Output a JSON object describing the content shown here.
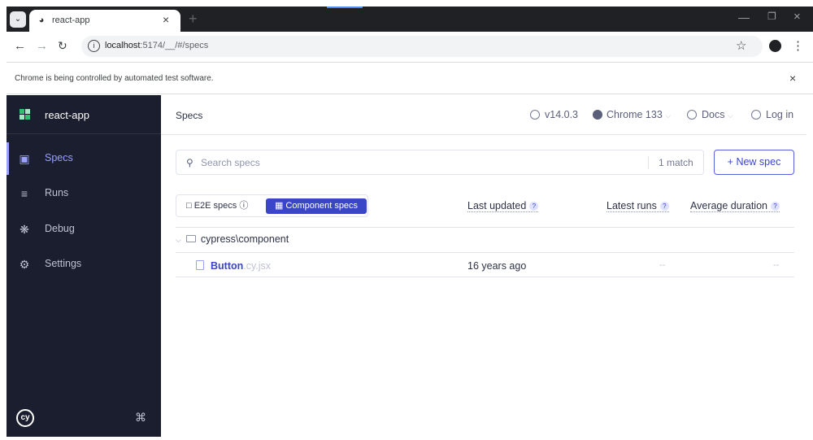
{
  "browser": {
    "tab_title": "react-app",
    "url_host": "localhost",
    "url_path": ":5174/__/#/specs",
    "infobar_text": "Chrome is being controlled by automated test software."
  },
  "sidebar": {
    "app_name": "react-app",
    "items": [
      {
        "label": "Specs",
        "icon": "specs-icon",
        "active": true
      },
      {
        "label": "Runs",
        "icon": "runs-icon",
        "active": false
      },
      {
        "label": "Debug",
        "icon": "bug-icon",
        "active": false
      },
      {
        "label": "Settings",
        "icon": "gear-icon",
        "active": false
      }
    ]
  },
  "header": {
    "breadcrumb": "Specs",
    "version": "v14.0.3",
    "browser": "Chrome 133",
    "docs": "Docs",
    "login": "Log in"
  },
  "search": {
    "placeholder": "Search specs",
    "match_count": "1 match",
    "new_spec_label": "+ New spec"
  },
  "table": {
    "switch": {
      "e2e": "E2E specs",
      "component": "Component specs"
    },
    "columns": {
      "last_updated": "Last updated",
      "latest_runs": "Latest runs",
      "average_duration": "Average duration"
    },
    "folder": "cypress\\component",
    "rows": [
      {
        "name": "Button",
        "ext": ".cy.jsx",
        "last_updated": "16 years ago",
        "latest_runs": "--",
        "average_duration": "--"
      }
    ]
  },
  "colors": {
    "sidebar_bg": "#1b1e2e",
    "accent": "#3a45c9",
    "active_nav": "#9aa2fc"
  }
}
